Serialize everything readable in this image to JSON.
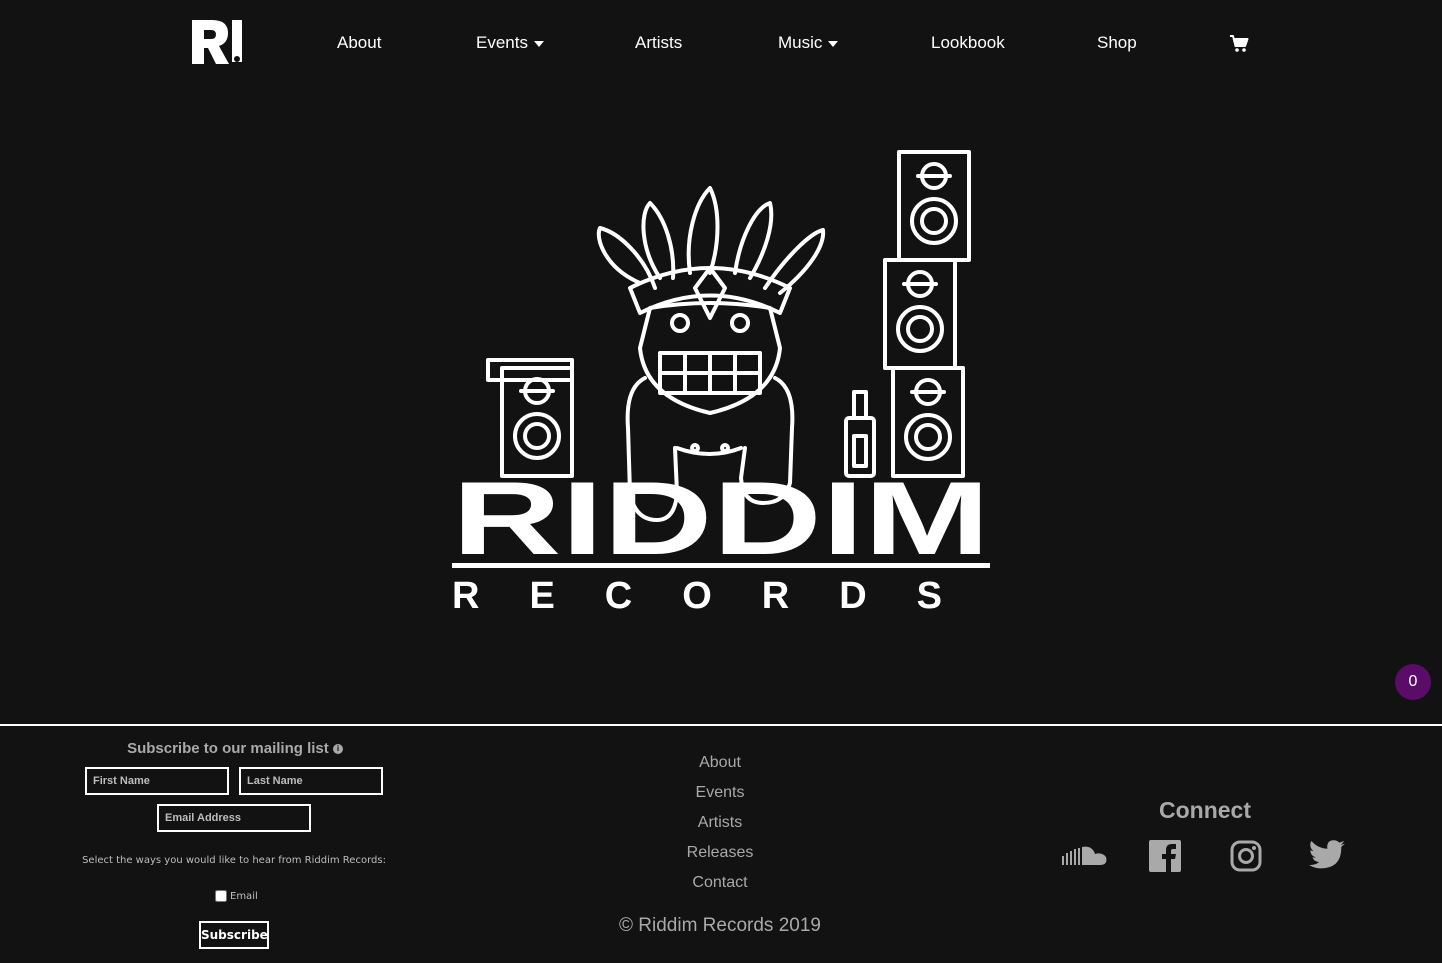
{
  "nav": {
    "logo_alt": "Riddim Records",
    "items": [
      {
        "label": "About",
        "has_dropdown": false
      },
      {
        "label": "Events",
        "has_dropdown": true
      },
      {
        "label": "Artists",
        "has_dropdown": false
      },
      {
        "label": "Music",
        "has_dropdown": true
      },
      {
        "label": "Lookbook",
        "has_dropdown": false
      },
      {
        "label": "Shop",
        "has_dropdown": false
      }
    ],
    "cart_icon": "shopping-cart-icon"
  },
  "hero": {
    "logo_word": "RIDDIM",
    "logo_subword": "RECORDS"
  },
  "cart_badge": {
    "count": "0",
    "color": "#5a0c68"
  },
  "mailing": {
    "title": "Subscribe to our mailing list",
    "info_icon": "info-icon",
    "first_name_placeholder": "First Name",
    "last_name_placeholder": "Last Name",
    "email_placeholder": "Email Address",
    "hint": "Select the ways you would like to hear from Riddim Records:",
    "email_option": "Email",
    "subscribe_label": "Subscribe"
  },
  "footer": {
    "links": [
      "About",
      "Events",
      "Artists",
      "Releases",
      "Contact"
    ],
    "copyright": "© Riddim Records 2019"
  },
  "connect": {
    "title": "Connect",
    "icons": [
      "soundcloud-icon",
      "facebook-icon",
      "instagram-icon",
      "twitter-icon"
    ]
  },
  "colors": {
    "background": "#121212",
    "text": "#ffffff",
    "muted": "#a9a9a9",
    "badge": "#5a0c68"
  }
}
